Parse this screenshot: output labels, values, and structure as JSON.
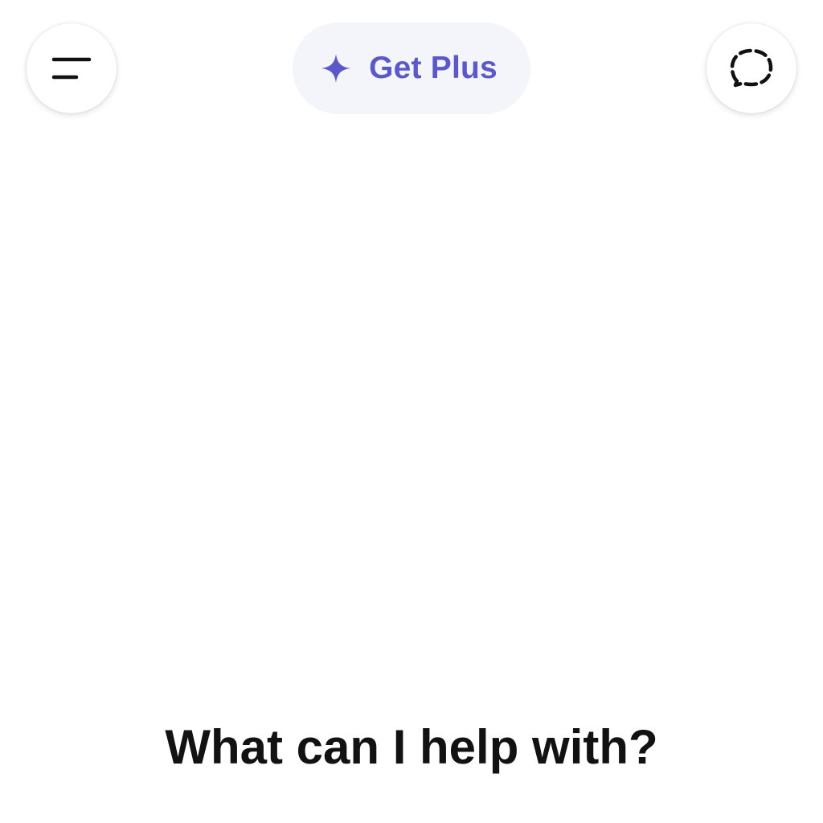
{
  "header": {
    "menu_icon": "menu-icon",
    "upgrade": {
      "icon": "sparkle-icon",
      "label": "Get Plus",
      "accent_color": "#5b59c9",
      "background": "#f4f4fb"
    },
    "new_chat_icon": "temporary-chat-icon"
  },
  "main": {
    "greeting": "What can I help with?"
  }
}
